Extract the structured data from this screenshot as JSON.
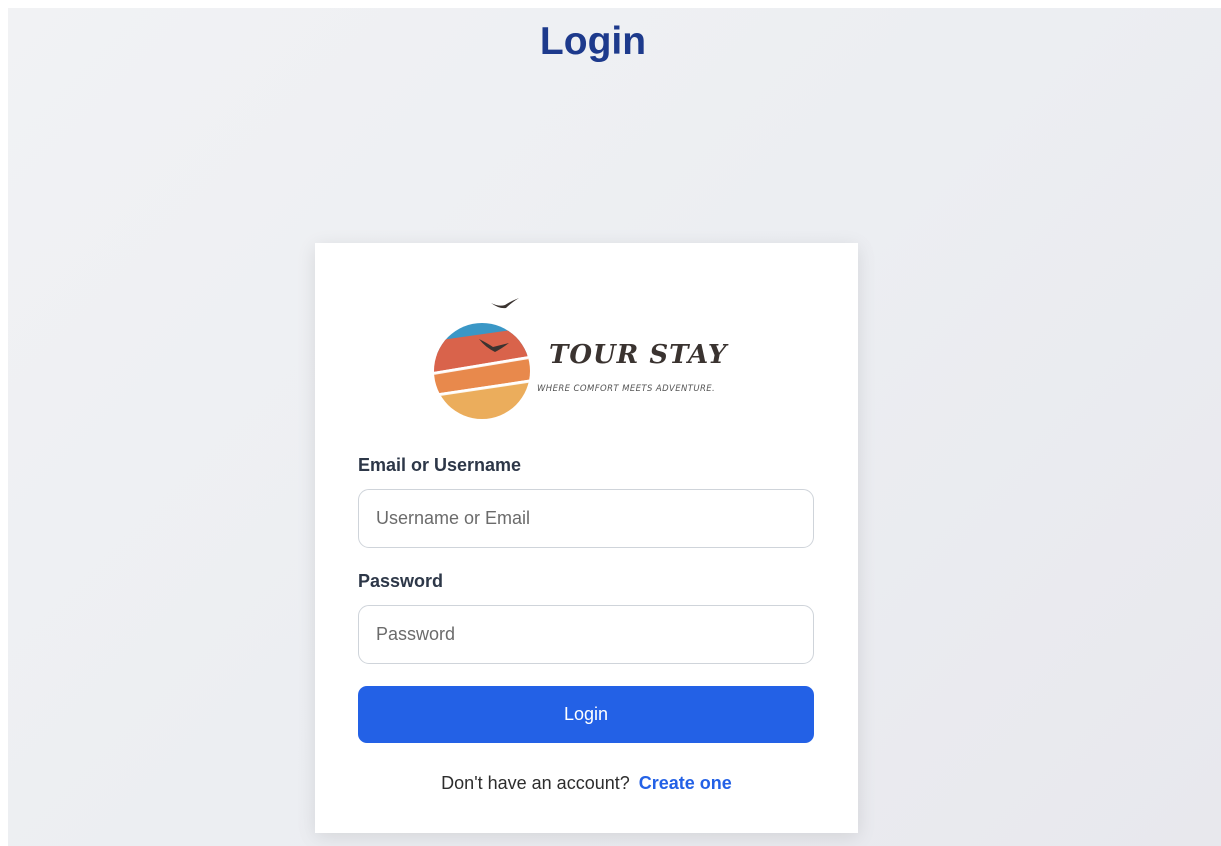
{
  "page": {
    "title": "Login"
  },
  "logo": {
    "brand_name": "TOUR STAY",
    "tagline": "WHERE COMFORT MEETS ADVENTURE.",
    "colors": {
      "blue": "#3a97c6",
      "red": "#d9634b",
      "orange": "#e8894c",
      "yellow": "#ebad5c",
      "ink": "#3a3330"
    }
  },
  "form": {
    "email_label": "Email or Username",
    "email_placeholder": "Username or Email",
    "password_label": "Password",
    "password_placeholder": "Password",
    "submit_label": "Login"
  },
  "signup": {
    "prompt": "Don't have an account?",
    "link_label": "Create one"
  },
  "colors": {
    "title": "#1d3a8c",
    "accent": "#2361e6"
  }
}
